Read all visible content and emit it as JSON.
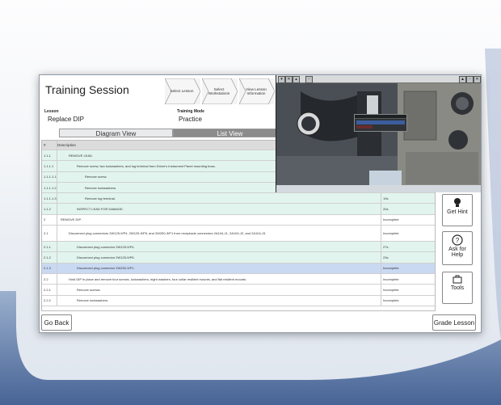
{
  "app": {
    "title": "Training Session"
  },
  "steps": [
    {
      "label": "Select Lesson"
    },
    {
      "label": "Select Workstations"
    },
    {
      "label": "View Lesson Information"
    }
  ],
  "lesson": {
    "label": "Lesson",
    "value": "Replace DIP",
    "mode_label": "Training Mode",
    "mode_value": "Practice"
  },
  "tabs": {
    "diagram": "Diagram View",
    "list": "List View"
  },
  "grid": {
    "headers": [
      "#",
      "Description",
      ""
    ],
    "rows": [
      {
        "num": "1.1.1",
        "desc": "REMOVE LEAD.",
        "status": "",
        "style": "green",
        "indent": 1
      },
      {
        "num": "1.1.1.1",
        "desc": "Remove screw, two lockwashers, and lug terminal from Driver's Instrument Panel mounting boss.",
        "status": "",
        "style": "green",
        "indent": 2
      },
      {
        "num": "1.1.1.1.1",
        "desc": "Remove screw.",
        "status": "",
        "style": "green",
        "indent": 3
      },
      {
        "num": "1.1.1.1.2",
        "desc": "Remove lockwashers.",
        "status": "",
        "style": "green",
        "indent": 3
      },
      {
        "num": "1.1.1.1.3",
        "desc": "Remove lug terminal.",
        "status": "19s",
        "style": "green",
        "indent": 3
      },
      {
        "num": "1.1.2",
        "desc": "INSPECT LEAD FOR DAMAGE.",
        "status": "20s",
        "style": "green",
        "indent": 2
      },
      {
        "num": "2",
        "desc": "REMOVE DIP.",
        "status": "Incomplete",
        "style": "white",
        "indent": 0
      },
      {
        "num": "2.1",
        "desc": "Disconnect plug connectors 2W125-9/P4, 2W125-9/P5, and 2W250-3/P1 from receptacle connectors 2A104-J1, 2A104-J2, and 2A104-J3.",
        "status": "Incomplete",
        "style": "white",
        "indent": 1,
        "tall": true
      },
      {
        "num": "2.1.1",
        "desc": "Disconnect plug connector 2W125-9/P4.",
        "status": "27s",
        "style": "green",
        "indent": 2
      },
      {
        "num": "2.1.2",
        "desc": "Disconnect plug connector 2W125-9/P5.",
        "status": "23s",
        "style": "green",
        "indent": 2
      },
      {
        "num": "2.1.3",
        "desc": "Disconnect plug connector 2W250-3/P1.",
        "status": "Incomplete",
        "style": "sel",
        "indent": 2
      },
      {
        "num": "2.2",
        "desc": "Hold DIP in place and remove four screws, lockwashers, eight washers, four collar resilient mounts, and flat resilient mounts.",
        "status": "Incomplete",
        "style": "white",
        "indent": 1
      },
      {
        "num": "2.2.1",
        "desc": "Remove screws.",
        "status": "Incomplete",
        "style": "white",
        "indent": 2
      },
      {
        "num": "2.2.2",
        "desc": "Remove lockwashers.",
        "status": "Incomplete",
        "style": "white",
        "indent": 2
      }
    ]
  },
  "side": {
    "hint": "Get Hint",
    "help": "Ask for Help",
    "tools": "Tools"
  },
  "footer": {
    "back": "Go Back",
    "grade": "Grade Lesson"
  },
  "colors": {
    "green_row": "#e2f4ee",
    "selected_row": "#c9d9f2",
    "tab_inactive": "#8c8c8c"
  }
}
